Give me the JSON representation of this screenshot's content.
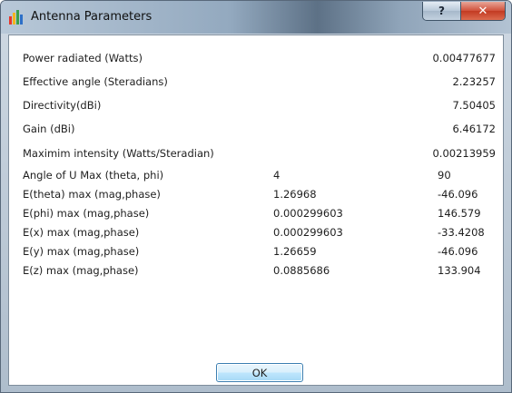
{
  "window": {
    "title": "Antenna Parameters",
    "help_label": "?",
    "close_label": "✕"
  },
  "summary_rows": [
    {
      "label": "Power radiated (Watts)",
      "value": "0.00477677"
    },
    {
      "label": "Effective angle (Steradians)",
      "value": "2.23257"
    },
    {
      "label": "Directivity(dBi)",
      "value": "7.50405"
    },
    {
      "label": "Gain (dBi)",
      "value": "6.46172"
    },
    {
      "label": "Maximim intensity (Watts/Steradian)",
      "value": "0.00213959"
    }
  ],
  "detail_rows": [
    {
      "label": "Angle of U Max (theta, phi)",
      "v1": "4",
      "v2": "90"
    },
    {
      "label": "E(theta) max (mag,phase)",
      "v1": "1.26968",
      "v2": "-46.096"
    },
    {
      "label": "E(phi) max (mag,phase)",
      "v1": "0.000299603",
      "v2": "146.579"
    },
    {
      "label": "E(x) max (mag,phase)",
      "v1": "0.000299603",
      "v2": "-33.4208"
    },
    {
      "label": "E(y) max (mag,phase)",
      "v1": "1.26659",
      "v2": "-46.096"
    },
    {
      "label": "E(z) max (mag,phase)",
      "v1": "0.0885686",
      "v2": "133.904"
    }
  ],
  "ok_label": "OK",
  "colors": {
    "ok_border": "#3c7fb1",
    "close_red": "#c23a22"
  }
}
